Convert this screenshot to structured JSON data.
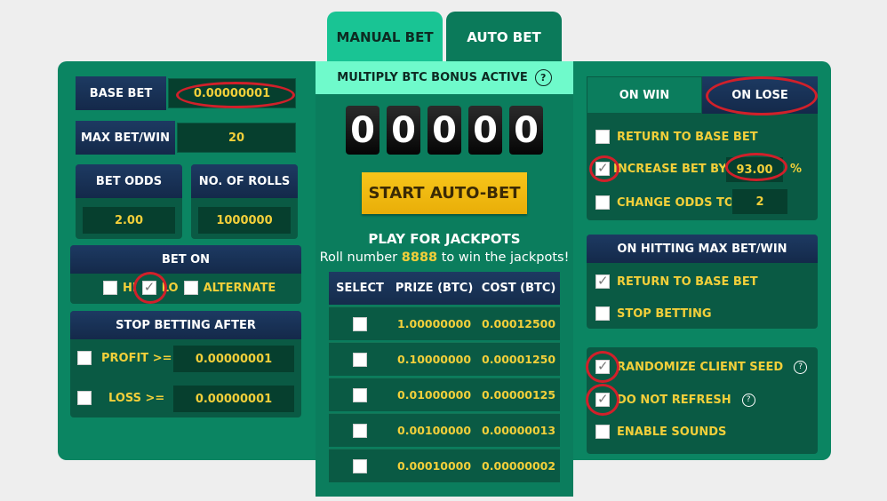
{
  "tabs": {
    "manual": "MANUAL BET",
    "auto": "AUTO BET"
  },
  "left": {
    "base_bet_label": "BASE BET",
    "base_bet_value": "0.00000001",
    "max_bet_label": "MAX BET/WIN",
    "max_bet_value": "20",
    "bet_odds_label": "BET ODDS",
    "bet_odds_value": "2.00",
    "rolls_label": "NO. OF ROLLS",
    "rolls_value": "1000000",
    "bet_on": {
      "title": "BET ON",
      "hi_label": "HI",
      "hi_checked": false,
      "lo_label": "LO",
      "lo_checked": true,
      "alternate_label": "ALTERNATE",
      "alternate_checked": false
    },
    "stop": {
      "title": "STOP BETTING AFTER",
      "profit_label": "PROFIT >=",
      "profit_value": "0.00000001",
      "profit_checked": false,
      "loss_label": "LOSS >=",
      "loss_value": "0.00000001",
      "loss_checked": false
    }
  },
  "center": {
    "bonus_text": "MULTIPLY BTC BONUS ACTIVE",
    "help_glyph": "?",
    "digits": [
      "0",
      "0",
      "0",
      "0",
      "0"
    ],
    "start_button": "START AUTO-BET",
    "jackpot_title": "PLAY FOR JACKPOTS",
    "jackpot_sub_pre": "Roll number",
    "jackpot_number": "8888",
    "jackpot_sub_post": "to win the jackpots!",
    "table": {
      "headers": [
        "SELECT",
        "PRIZE (BTC)",
        "COST (BTC)"
      ],
      "rows": [
        {
          "prize": "1.00000000",
          "cost": "0.00012500",
          "selected": false
        },
        {
          "prize": "0.10000000",
          "cost": "0.00001250",
          "selected": false
        },
        {
          "prize": "0.01000000",
          "cost": "0.00000125",
          "selected": false
        },
        {
          "prize": "0.00100000",
          "cost": "0.00000013",
          "selected": false
        },
        {
          "prize": "0.00010000",
          "cost": "0.00000002",
          "selected": false
        }
      ]
    }
  },
  "right": {
    "on_win_tab": "ON WIN",
    "on_lose_tab": "ON LOSE",
    "return_base": "RETURN TO BASE BET",
    "return_base_checked": false,
    "increase_label": "INCREASE BET BY",
    "increase_checked": true,
    "increase_value": "93.00",
    "percent": "%",
    "change_odds_label": "CHANGE ODDS TO",
    "change_odds_checked": false,
    "change_odds_value": "2",
    "max_title": "ON HITTING MAX BET/WIN",
    "max_return": "RETURN TO BASE BET",
    "max_return_checked": true,
    "max_stop": "STOP BETTING",
    "max_stop_checked": false,
    "randomize": "RANDOMIZE CLIENT SEED",
    "randomize_checked": true,
    "no_refresh": "DO NOT REFRESH",
    "no_refresh_checked": true,
    "sounds": "ENABLE SOUNDS",
    "sounds_checked": false
  }
}
